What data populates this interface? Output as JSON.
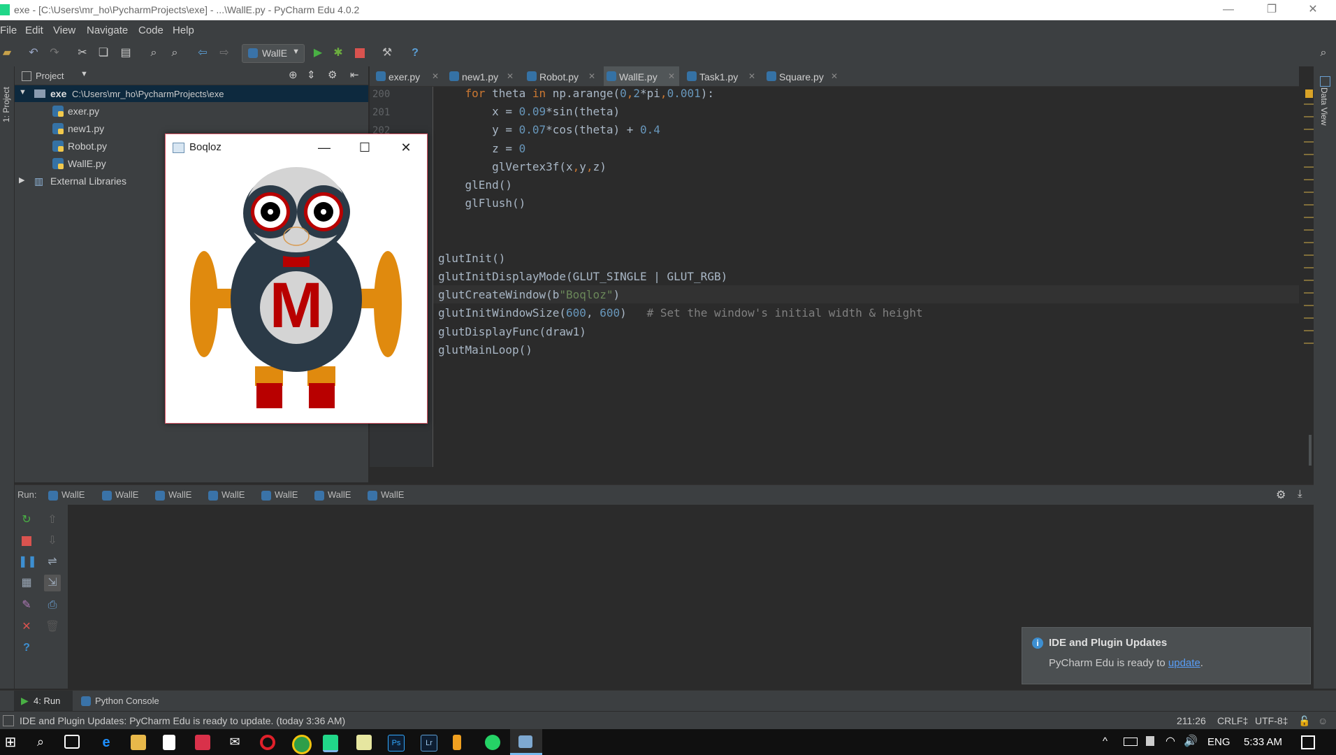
{
  "window": {
    "title": "exe - [C:\\Users\\mr_ho\\PycharmProjects\\exe] - ...\\WallE.py - PyCharm Edu 4.0.2",
    "minimize": "—",
    "restore": "❐",
    "close": "✕"
  },
  "menu": [
    "File",
    "Edit",
    "View",
    "Navigate",
    "Code",
    "Help"
  ],
  "toolbar": {
    "run_config": "WallE",
    "help": "?"
  },
  "left_strip": {
    "project_tab": "1: Project"
  },
  "project": {
    "header": "Project",
    "root_name": "exe",
    "root_path": "C:\\Users\\mr_ho\\PycharmProjects\\exe",
    "files": [
      "exer.py",
      "new1.py",
      "Robot.py",
      "WallE.py"
    ],
    "external": "External Libraries"
  },
  "tabs": [
    "exer.py",
    "new1.py",
    "Robot.py",
    "WallE.py",
    "Task1.py",
    "Square.py"
  ],
  "active_tab": "WallE.py",
  "editor": {
    "line_numbers": [
      "200",
      "201",
      "202"
    ],
    "lines": [
      {
        "indent": "    ",
        "parts": [
          [
            "kw",
            "for "
          ],
          [
            "t",
            "theta "
          ],
          [
            "kw",
            "in "
          ],
          [
            "t",
            "np.arange("
          ],
          [
            "num",
            "0"
          ],
          [
            "kw",
            ","
          ],
          [
            "num",
            "2"
          ],
          [
            "t",
            "*pi"
          ],
          [
            "kw",
            ","
          ],
          [
            "num",
            "0.001"
          ],
          [
            "t",
            "):"
          ]
        ]
      },
      {
        "indent": "        ",
        "parts": [
          [
            "t",
            "x = "
          ],
          [
            "num",
            "0.09"
          ],
          [
            "t",
            "*sin(theta)"
          ]
        ]
      },
      {
        "indent": "        ",
        "parts": [
          [
            "t",
            "y = "
          ],
          [
            "num",
            "0.07"
          ],
          [
            "t",
            "*cos(theta) + "
          ],
          [
            "num",
            "0.4"
          ]
        ]
      },
      {
        "indent": "        ",
        "parts": [
          [
            "t",
            "z = "
          ],
          [
            "num",
            "0"
          ]
        ]
      },
      {
        "indent": "        ",
        "parts": [
          [
            "t",
            "glVertex3f(x"
          ],
          [
            "kw",
            ","
          ],
          [
            "t",
            "y"
          ],
          [
            "kw",
            ","
          ],
          [
            "t",
            "z)"
          ]
        ]
      },
      {
        "indent": "    ",
        "parts": [
          [
            "t",
            "glEnd()"
          ]
        ]
      },
      {
        "indent": "    ",
        "parts": [
          [
            "t",
            "glFlush()"
          ]
        ]
      },
      {
        "indent": "",
        "parts": []
      },
      {
        "indent": "",
        "parts": []
      },
      {
        "indent": "",
        "parts": [
          [
            "t",
            "glutInit()"
          ]
        ]
      },
      {
        "indent": "",
        "parts": [
          [
            "t",
            "glutInitDisplayMode(GLUT_SINGLE | GLUT_RGB)"
          ]
        ]
      },
      {
        "indent": "",
        "parts": [
          [
            "t",
            "glutCreateWindow(b"
          ],
          [
            "str",
            "\"Boqloz\""
          ],
          [
            "t",
            ")"
          ]
        ]
      },
      {
        "indent": "",
        "parts": [
          [
            "t",
            "glutInitWindowSize("
          ],
          [
            "num",
            "600"
          ],
          [
            "t",
            ", "
          ],
          [
            "num",
            "600"
          ],
          [
            "t",
            ")   "
          ],
          [
            "cmt",
            "# Set the window's initial width & height"
          ]
        ]
      },
      {
        "indent": "",
        "parts": [
          [
            "t",
            "glutDisplayFunc(draw1)"
          ]
        ]
      },
      {
        "indent": "",
        "parts": [
          [
            "t",
            "glutMainLoop()"
          ]
        ]
      }
    ]
  },
  "right_strip": {
    "data_view": "Data View"
  },
  "run": {
    "label": "Run:",
    "tabs": [
      "WallE",
      "WallE",
      "WallE",
      "WallE",
      "WallE",
      "WallE",
      "WallE"
    ]
  },
  "bottom_tabs": {
    "run": "4: Run",
    "console": "Python Console"
  },
  "status": {
    "message": "IDE and Plugin Updates: PyCharm Edu is ready to update. (today 3:36 AM)",
    "position": "211:26",
    "line_sep": "CRLF‡",
    "encoding": "UTF-8‡"
  },
  "notification": {
    "title": "IDE and Plugin Updates",
    "body": "PyCharm Edu is ready to ",
    "link": "update",
    "tail": "."
  },
  "gl_window": {
    "title": "Boqloz",
    "letter": "M"
  },
  "taskbar": {
    "lang": "ENG",
    "time": "5:33 AM"
  },
  "colors": {
    "editor_bg": "#2b2b2b",
    "robot_body": "#2b3a47",
    "robot_orange": "#e08a0e",
    "robot_red": "#b80000",
    "robot_grey": "#d4d4d4"
  }
}
